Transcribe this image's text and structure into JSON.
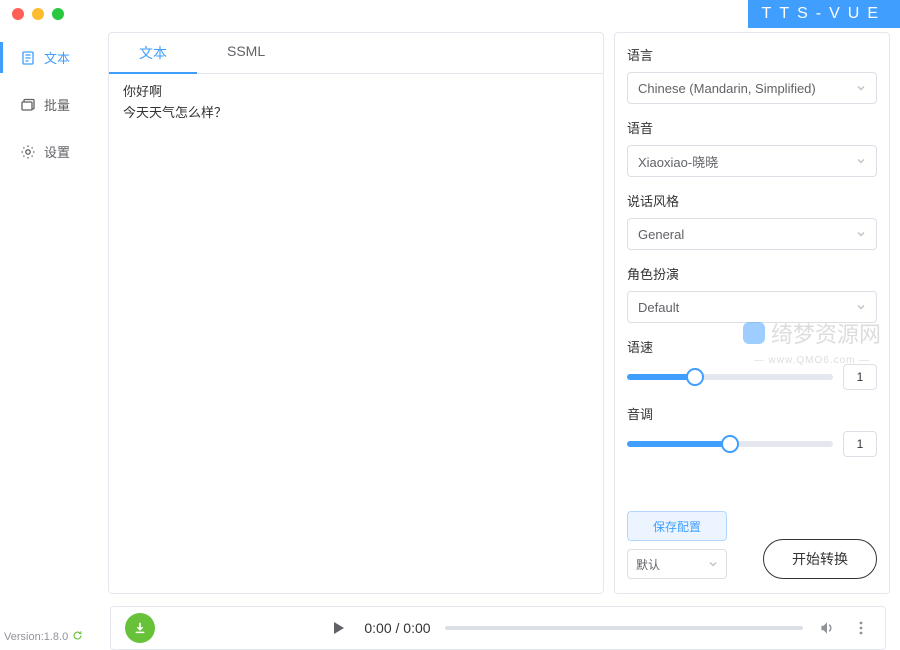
{
  "app": {
    "title": "TTS-VUE"
  },
  "traffic": {
    "close": "close",
    "min": "minimize",
    "max": "maximize"
  },
  "sidebar": {
    "items": [
      {
        "label": "文本",
        "name": "sidebar-item-text",
        "active": true
      },
      {
        "label": "批量",
        "name": "sidebar-item-batch",
        "active": false
      },
      {
        "label": "设置",
        "name": "sidebar-item-settings",
        "active": false
      }
    ]
  },
  "version": {
    "label": "Version:1.8.0"
  },
  "editor": {
    "tabs": [
      {
        "label": "文本",
        "active": true
      },
      {
        "label": "SSML",
        "active": false
      }
    ],
    "lines": [
      "你好啊",
      "今天天气怎么样？"
    ]
  },
  "settings": {
    "language": {
      "label": "语言",
      "value": "Chinese (Mandarin, Simplified)"
    },
    "voice": {
      "label": "语音",
      "value": "Xiaoxiao-晓晓"
    },
    "style": {
      "label": "说话风格",
      "value": "General"
    },
    "role": {
      "label": "角色扮演",
      "value": "Default"
    },
    "speed": {
      "label": "语速",
      "value": "1",
      "percent": 33
    },
    "pitch": {
      "label": "音调",
      "value": "1",
      "percent": 50
    },
    "save_label": "保存配置",
    "preset_label": "默认",
    "start_label": "开始转换"
  },
  "watermark": {
    "text": "绮梦资源网",
    "url": "— www.QMO6.com —"
  },
  "player": {
    "time": "0:00 / 0:00"
  }
}
